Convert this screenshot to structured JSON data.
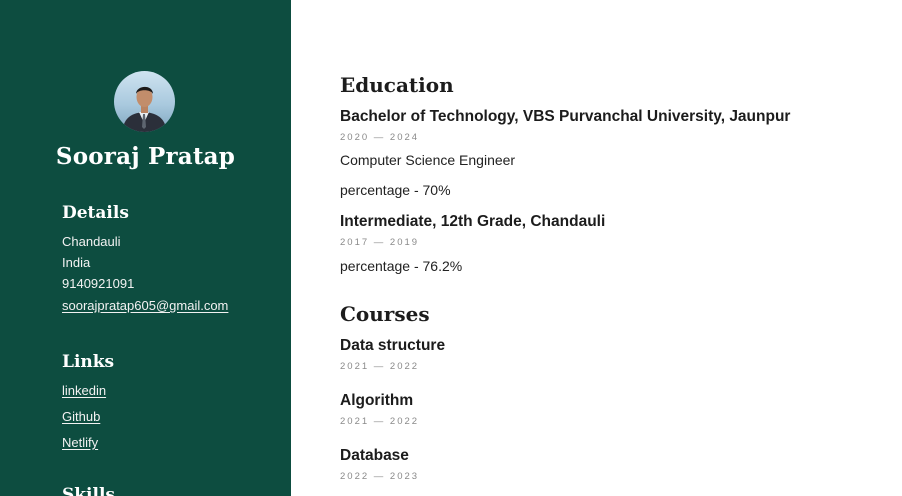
{
  "profile": {
    "name": "Sooraj Pratap"
  },
  "details": {
    "heading": "Details",
    "city": "Chandauli",
    "country": "India",
    "phone": "9140921091",
    "email": "soorajpratap605@gmail.com"
  },
  "links": {
    "heading": "Links",
    "items": [
      "linkedin",
      "Github",
      "Netlify"
    ]
  },
  "skills": {
    "heading": "Skills"
  },
  "education": {
    "heading": "Education",
    "entries": [
      {
        "title": "Bachelor of Technology, VBS Purvanchal University, Jaunpur",
        "dates": "2020 — 2024",
        "lines": [
          "Computer Science Engineer",
          "percentage - 70%"
        ]
      },
      {
        "title": "Intermediate, 12th Grade, Chandauli",
        "dates": "2017 — 2019",
        "lines": [
          "percentage - 76.2%"
        ]
      }
    ]
  },
  "courses": {
    "heading": "Courses",
    "entries": [
      {
        "title": "Data structure",
        "dates": "2021 — 2022"
      },
      {
        "title": "Algorithm",
        "dates": "2021 — 2022"
      },
      {
        "title": "Database",
        "dates": "2022 — 2023"
      }
    ]
  },
  "colors": {
    "sidebar_bg": "#0d4d40",
    "sidebar_text": "#ffffff",
    "date_text": "#8a8a8a"
  }
}
